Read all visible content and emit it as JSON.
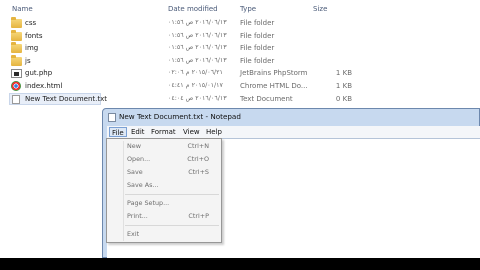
{
  "explorer": {
    "columns": {
      "name": "Name",
      "date": "Date modified",
      "type": "Type",
      "size": "Size"
    },
    "files": [
      {
        "icon": "folder-icon",
        "name": "css",
        "date": "٢٠١٦/٠٦/١٣ ص ٠١:٥٦",
        "type": "File folder",
        "size": ""
      },
      {
        "icon": "folder-icon",
        "name": "fonts",
        "date": "٢٠١٦/٠٦/١٣ ص ٠١:٥٦",
        "type": "File folder",
        "size": ""
      },
      {
        "icon": "folder-icon",
        "name": "img",
        "date": "٢٠١٦/٠٦/١٣ ص ٠١:٥٦",
        "type": "File folder",
        "size": ""
      },
      {
        "icon": "folder-icon",
        "name": "js",
        "date": "٢٠١٦/٠٦/١٣ ص ٠١:٥٦",
        "type": "File folder",
        "size": ""
      },
      {
        "icon": "php-file-icon",
        "name": "gut.php",
        "date": "٢٠١٥/٠٦/٢١ م ٠٢:٠٦",
        "type": "JetBrains PhpStorm",
        "size": "1 KB"
      },
      {
        "icon": "html-file-icon",
        "name": "index.html",
        "date": "٢٠١٥/٠١/١٧ م ٠٤:٤١",
        "type": "Chrome HTML Do...",
        "size": "1 KB"
      },
      {
        "icon": "text-file-icon",
        "name": "New Text Document.txt",
        "date": "٢٠١٦/٠٦/١٣ ص ٠٤:٠٤",
        "type": "Text Document",
        "size": "0 KB"
      }
    ]
  },
  "notepad": {
    "title": "New Text Document.txt - Notepad",
    "menu": [
      "File",
      "Edit",
      "Format",
      "View",
      "Help"
    ],
    "file_menu": [
      {
        "label": "New",
        "shortcut": "Ctrl+N"
      },
      {
        "label": "Open...",
        "shortcut": "Ctrl+O"
      },
      {
        "label": "Save",
        "shortcut": "Ctrl+S"
      },
      {
        "label": "Save As...",
        "shortcut": ""
      },
      {
        "label": "Page Setup...",
        "shortcut": ""
      },
      {
        "label": "Print...",
        "shortcut": "Ctrl+P"
      },
      {
        "label": "Exit",
        "shortcut": ""
      }
    ]
  }
}
